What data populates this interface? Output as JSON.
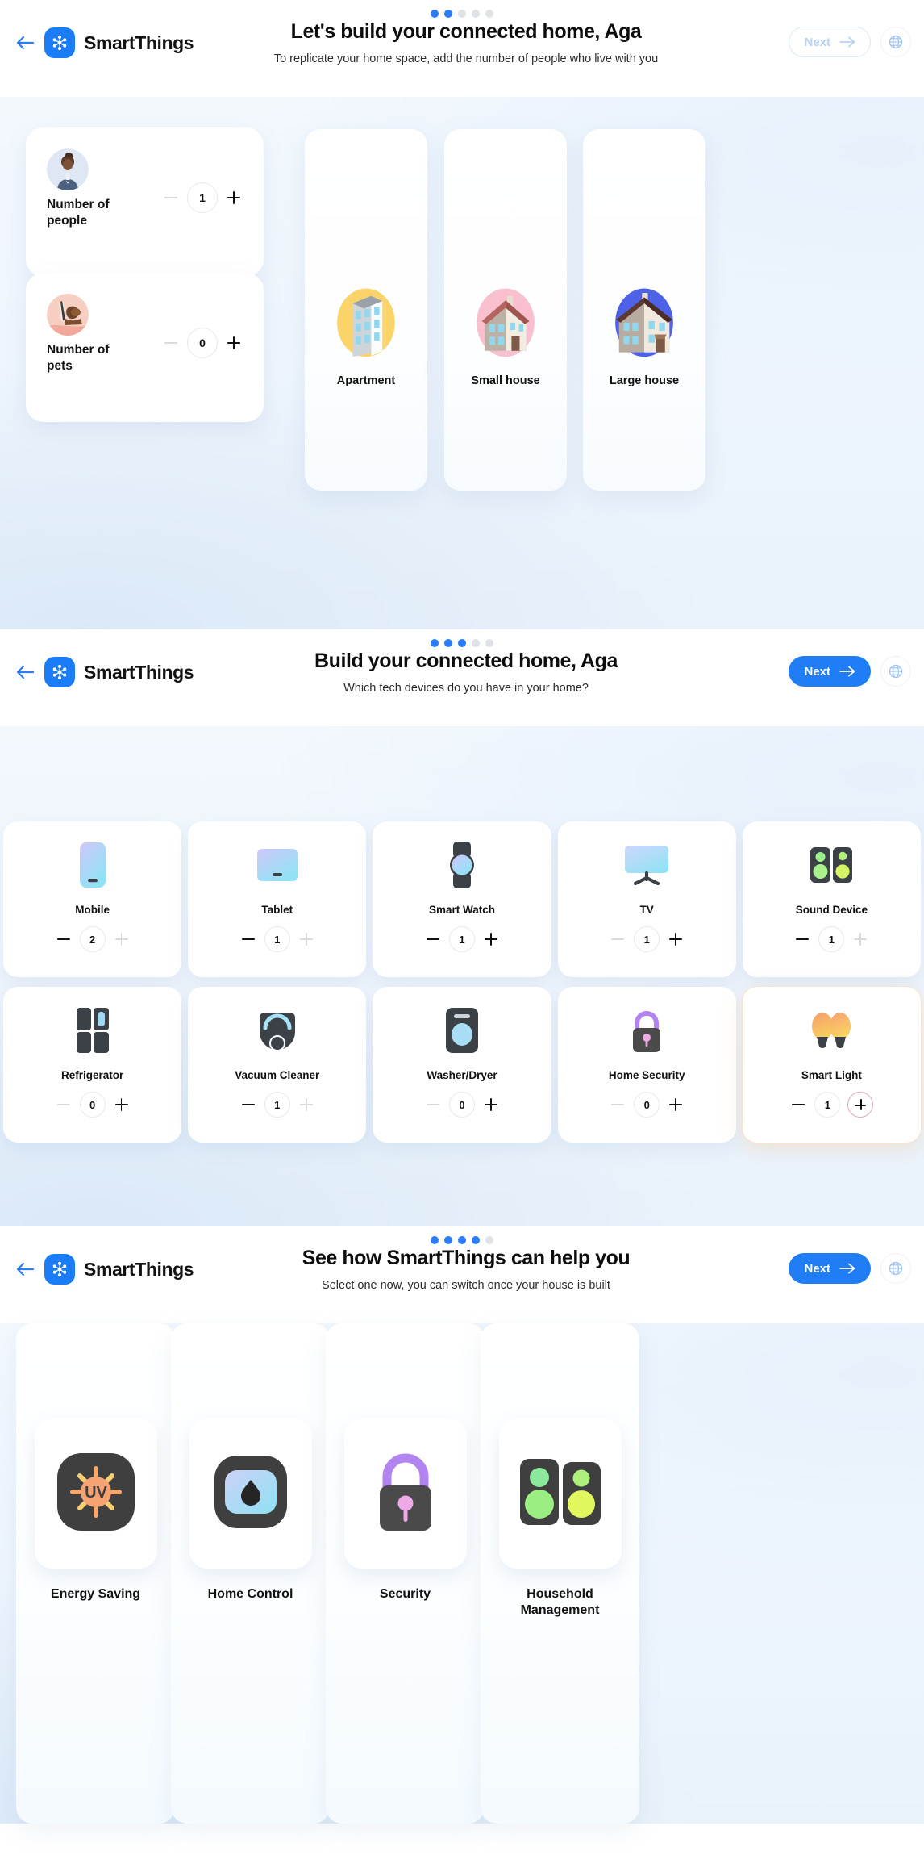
{
  "brand": {
    "name": "SmartThings",
    "back_icon": "back-arrow-icon",
    "logo_icon": "smartthings-logo-icon"
  },
  "sections": [
    {
      "id": "household",
      "dots_total": 5,
      "dots_active": 2,
      "title": "Let's build your connected home, Aga",
      "subtitle": "To replicate your home space, add the number of people who live with you",
      "next_label": "Next",
      "next_state": "disabled",
      "globe_icon": "globe-icon",
      "counters": [
        {
          "label": "Number of people",
          "value": "1",
          "avatar_icon": "person-avatar-icon",
          "minus_enabled": false,
          "plus_enabled": true
        },
        {
          "label": "Number of pets",
          "value": "0",
          "avatar_icon": "pet-avatar-icon",
          "minus_enabled": false,
          "plus_enabled": true
        }
      ],
      "home_types": [
        {
          "label": "Apartment",
          "icon": "apartment-building-icon",
          "accent": "#FAD36B"
        },
        {
          "label": "Small house",
          "icon": "small-house-icon",
          "accent": "#F8C0CE"
        },
        {
          "label": "Large house",
          "icon": "large-house-icon",
          "accent": "#4E62E8"
        }
      ]
    },
    {
      "id": "devices",
      "dots_total": 5,
      "dots_active": 3,
      "title": "Build your connected home, Aga",
      "subtitle": "Which tech devices do you have in your home?",
      "next_label": "Next",
      "next_state": "enabled",
      "globe_icon": "globe-icon",
      "devices": [
        {
          "label": "Mobile",
          "icon": "mobile-phone-icon",
          "value": "2",
          "minus_enabled": true,
          "plus_enabled": false,
          "highlighted": false
        },
        {
          "label": "Tablet",
          "icon": "tablet-icon",
          "value": "1",
          "minus_enabled": true,
          "plus_enabled": false,
          "highlighted": false
        },
        {
          "label": "Smart Watch",
          "icon": "smart-watch-icon",
          "value": "1",
          "minus_enabled": true,
          "plus_enabled": true,
          "highlighted": false
        },
        {
          "label": "TV",
          "icon": "tv-icon",
          "value": "1",
          "minus_enabled": false,
          "plus_enabled": true,
          "highlighted": false
        },
        {
          "label": "Sound Device",
          "icon": "sound-speaker-icon",
          "value": "1",
          "minus_enabled": true,
          "plus_enabled": false,
          "highlighted": false
        },
        {
          "label": "Refrigerator",
          "icon": "refrigerator-icon",
          "value": "0",
          "minus_enabled": false,
          "plus_enabled": true,
          "highlighted": false
        },
        {
          "label": "Vacuum Cleaner",
          "icon": "robot-vacuum-icon",
          "value": "1",
          "minus_enabled": true,
          "plus_enabled": false,
          "highlighted": false
        },
        {
          "label": "Washer/Dryer",
          "icon": "washer-dryer-icon",
          "value": "0",
          "minus_enabled": false,
          "plus_enabled": true,
          "highlighted": false
        },
        {
          "label": "Home Security",
          "icon": "padlock-icon",
          "value": "0",
          "minus_enabled": false,
          "plus_enabled": true,
          "highlighted": false
        },
        {
          "label": "Smart Light",
          "icon": "smart-bulbs-icon",
          "value": "1",
          "minus_enabled": true,
          "plus_enabled": true,
          "highlighted": true
        }
      ]
    },
    {
      "id": "benefits",
      "dots_total": 5,
      "dots_active": 4,
      "title": "See how SmartThings can help you",
      "subtitle": "Select one now, you can switch once your house is built",
      "next_label": "Next",
      "next_state": "enabled",
      "globe_icon": "globe-icon",
      "benefits": [
        {
          "label": "Energy Saving",
          "icon": "uv-sun-icon",
          "badge_text": "UV"
        },
        {
          "label": "Home Control",
          "icon": "water-drop-icon",
          "badge_text": ""
        },
        {
          "label": "Security",
          "icon": "padlock-icon",
          "badge_text": ""
        },
        {
          "label": "Household Management",
          "icon": "speakers-icon",
          "badge_text": ""
        }
      ]
    }
  ],
  "colors": {
    "accent_blue": "#1F7DF6",
    "dot_active": "#2B7CF6",
    "dot_inactive": "#DFE2E6",
    "highlight_orange": "#F0B478"
  }
}
